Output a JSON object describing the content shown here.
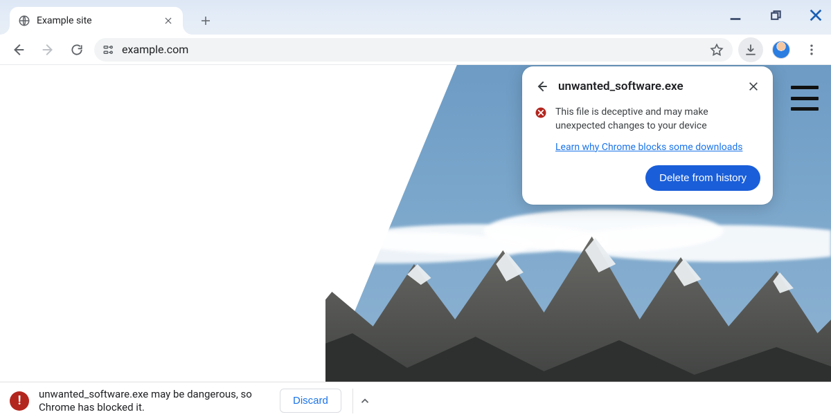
{
  "tab": {
    "title": "Example site"
  },
  "omnibox": {
    "url": "example.com"
  },
  "popover": {
    "filename": "unwanted_software.exe",
    "warning": "This file is deceptive and may make unexpected changes to your device",
    "learn_link": "Learn why Chrome blocks some downloads",
    "delete_label": "Delete from history"
  },
  "dlbar": {
    "message": "unwanted_software.exe may be dangerous, so Chrome has blocked it.",
    "discard_label": "Discard"
  }
}
